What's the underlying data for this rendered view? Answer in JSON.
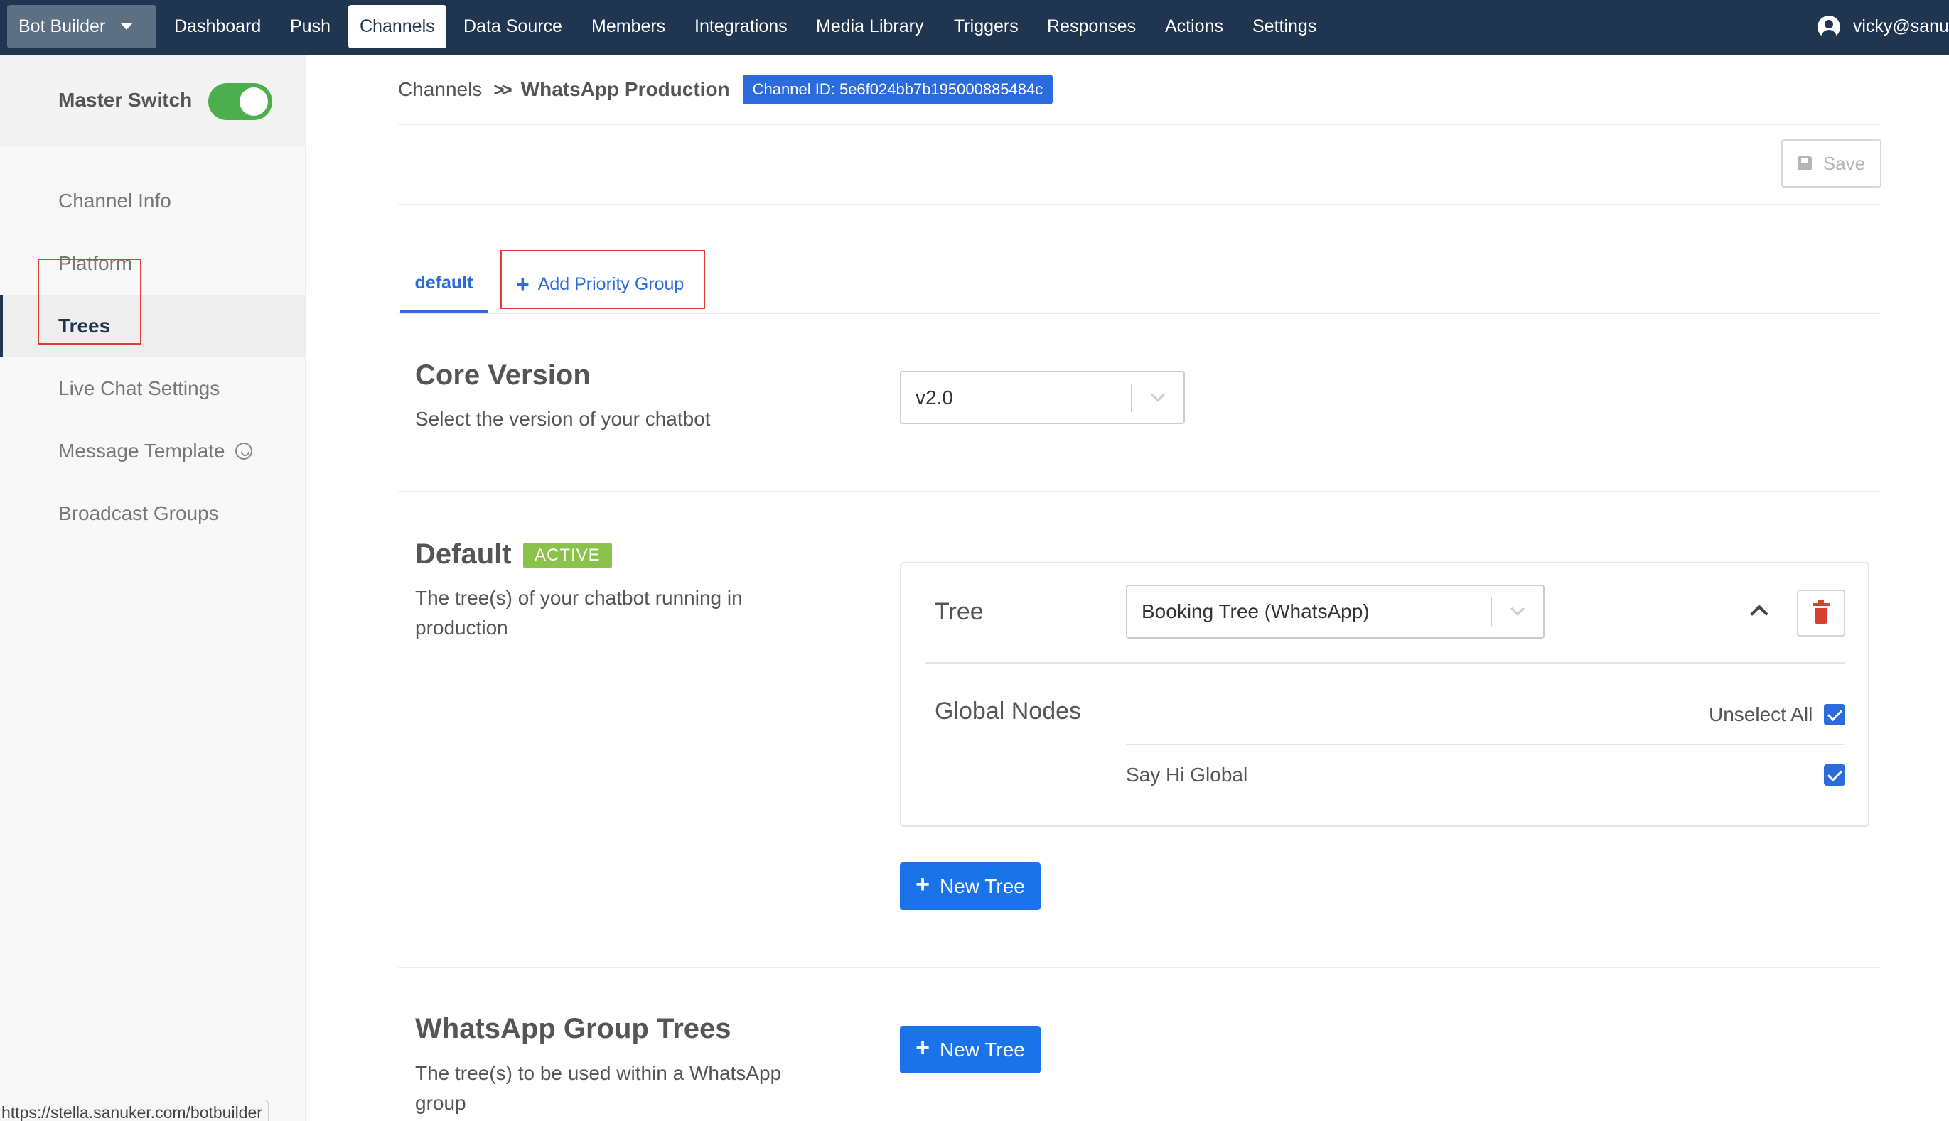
{
  "topnav": {
    "brand": "Bot Builder",
    "items": [
      "Dashboard",
      "Push",
      "Channels",
      "Data Source",
      "Members",
      "Integrations",
      "Media Library",
      "Triggers",
      "Responses",
      "Actions",
      "Settings"
    ],
    "active": "Channels",
    "user": "vicky@sanu",
    "colors": {
      "bar": "#1f3550",
      "brand_button": "#5d6f82"
    }
  },
  "sidebar": {
    "master_switch_label": "Master Switch",
    "master_switch_on": true,
    "items": [
      {
        "label": "Channel Info"
      },
      {
        "label": "Platform"
      },
      {
        "label": "Trees",
        "active": true
      },
      {
        "label": "Live Chat Settings"
      },
      {
        "label": "Message Template",
        "icon": "whatsapp-icon"
      },
      {
        "label": "Broadcast Groups"
      }
    ],
    "status_url": "https://stella.sanuker.com/botbuilder"
  },
  "header": {
    "breadcrumb": [
      "Channels",
      "WhatsApp Production"
    ],
    "channel_id": "Channel ID: 5e6f024bb7b195000885484c",
    "save_label": "Save"
  },
  "tabs": {
    "default_label": "default",
    "add_label": "Add Priority Group"
  },
  "core_version": {
    "title": "Core Version",
    "description": "Select the version of your chatbot",
    "selected": "v2.0"
  },
  "default_section": {
    "title": "Default",
    "badge": "ACTIVE",
    "description": "The tree(s) of your chatbot running in production",
    "tree_label": "Tree",
    "tree_selected": "Booking Tree (WhatsApp)",
    "global_nodes_label": "Global Nodes",
    "unselect_all_label": "Unselect All",
    "unselect_all_checked": true,
    "nodes": [
      {
        "name": "Say Hi Global",
        "checked": true
      }
    ],
    "new_tree_label": "New Tree"
  },
  "whatsapp_group": {
    "title": "WhatsApp Group Trees",
    "description": "The tree(s) to be used within a WhatsApp group",
    "new_tree_label": "New Tree"
  },
  "colors": {
    "primary": "#2b6bdc",
    "button": "#1a73e8",
    "active_badge": "#8bc34a",
    "toggle_on": "#4cae4c",
    "delete": "#d9412f",
    "highlight_box": "#e53935"
  }
}
